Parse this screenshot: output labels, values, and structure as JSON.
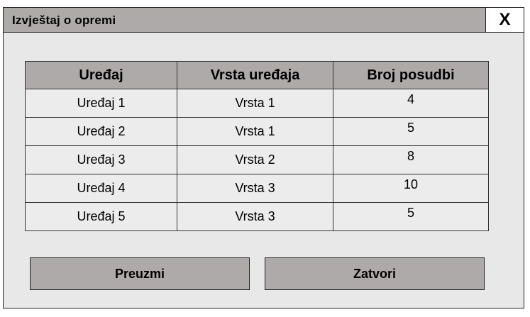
{
  "window": {
    "title": "Izvještaj o opremi",
    "close_label": "X"
  },
  "table": {
    "headers": [
      "Uređaj",
      "Vrsta uređaja",
      "Broj posudbi"
    ],
    "rows": [
      [
        "Uređaj 1",
        "Vrsta 1",
        "4"
      ],
      [
        "Uređaj 2",
        "Vrsta 1",
        "5"
      ],
      [
        "Uređaj 3",
        "Vrsta 2",
        "8"
      ],
      [
        "Uređaj 4",
        "Vrsta 3",
        "10"
      ],
      [
        "Uređaj 5",
        "Vrsta 3",
        "5"
      ]
    ]
  },
  "buttons": {
    "download_label": "Preuzmi",
    "close_label": "Zatvori"
  },
  "colors": {
    "header_gray": "#aeaaaa",
    "panel_bg": "#e8e8e8"
  }
}
